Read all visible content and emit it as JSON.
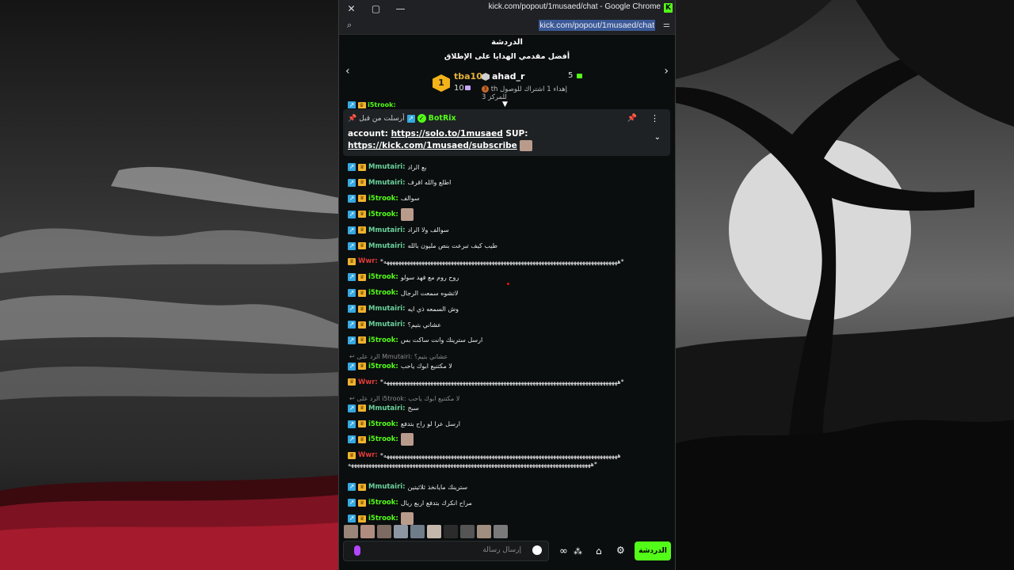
{
  "browser": {
    "title": "kick.com/popout/1musaed/chat - Google Chrome",
    "url": "kick.com/popout/1musaed/chat",
    "controls": {
      "close": "✕",
      "maximize": "▢",
      "minimize": "—"
    }
  },
  "chat": {
    "header": "الدردشة",
    "gifters_title": "أفضل مقدمي الهدايا على الإطلاق",
    "gifters": [
      {
        "rank": "1",
        "name": "tba10",
        "count": "10"
      },
      {
        "rank": "",
        "name": "ahad_r",
        "count": "5"
      }
    ],
    "third_note": "th إهداء 1 اشتراك للوصول للمركز 3",
    "third_badge": "3",
    "peek_text": "i5trook:",
    "pinned": {
      "label": "أرسلت من قبل",
      "author": "BotRix",
      "text_prefix": "account: ",
      "link1": "https://solo.to/1musaed",
      "mid": " SUP: ",
      "link2": "https://kick.com/1musaed/subscribe"
    },
    "messages": [
      {
        "user": "Mmutairi:",
        "color": "#6ad39c",
        "text": "بع الراد",
        "badges": "both"
      },
      {
        "user": "Mmutairi:",
        "color": "#6ad39c",
        "text": "اطلع والله اقرف",
        "badges": "both"
      },
      {
        "user": "i5trook:",
        "color": "#53fc18",
        "text": "سوالف",
        "badges": "both"
      },
      {
        "user": "i5trook:",
        "color": "#53fc18",
        "text": "",
        "badges": "both",
        "emote": true
      },
      {
        "user": "Mmutairi:",
        "color": "#6ad39c",
        "text": "سوالف ولا الراد",
        "badges": "both"
      },
      {
        "user": "Mmutairi:",
        "color": "#6ad39c",
        "text": "طيب كيف تبرعت بنص مليون بالله",
        "badges": "both"
      },
      {
        "user": "Wwr:",
        "color": "#e33b3b",
        "text": "*ههههههههههههههههههههههههههههههههههههههههههههههههههههههههههههههههههههههههههههههههه*",
        "badges": "crown"
      },
      {
        "user": "i5trook:",
        "color": "#53fc18",
        "text": "روح روم مع فهد سولو",
        "badges": "both"
      },
      {
        "user": "i5trook:",
        "color": "#53fc18",
        "text": "لاتشوه سمعت الرجال",
        "badges": "both"
      },
      {
        "user": "Mmutairi:",
        "color": "#6ad39c",
        "text": "وش السمعه ذي ايه",
        "badges": "both"
      },
      {
        "user": "Mmutairi:",
        "color": "#6ad39c",
        "text": "عشاني بتيم؟",
        "badges": "both"
      },
      {
        "user": "i5trook:",
        "color": "#53fc18",
        "text": "ارسل سترينك وانت ساكت بس",
        "badges": "both"
      }
    ],
    "reply1_header": "الرد على Mmutairi: عشاني بتيم؟",
    "messages2": [
      {
        "user": "i5trook:",
        "color": "#53fc18",
        "text": "لا مكتنيع ابوك ياحب",
        "badges": "both"
      },
      {
        "user": "Wwr:",
        "color": "#e33b3b",
        "text": "*ههههههههههههههههههههههههههههههههههههههههههههههههههههههههههههههههههههههههههههههههه*",
        "badges": "crown"
      }
    ],
    "reply2_header": "الرد على i5trook: لا مكتنيع ابوك ياحب",
    "messages3": [
      {
        "user": "Mmutairi:",
        "color": "#6ad39c",
        "text": "سبح",
        "badges": "both"
      },
      {
        "user": "i5trook:",
        "color": "#53fc18",
        "text": "ارسل عرا لو راح بتدفع",
        "badges": "both"
      },
      {
        "user": "i5trook:",
        "color": "#53fc18",
        "text": "",
        "badges": "both",
        "emote": true
      },
      {
        "user": "Wwr:",
        "color": "#e33b3b",
        "text": "*ههههههههههههههههههههههههههههههههههههههههههههههههههههههههههههههههههههههههههههههههه",
        "badges": "crown"
      },
      {
        "user": "",
        "color": "#e9e9e9",
        "text": "هههههههههههههههههههههههههههههههههههههههههههههههههههههههههههههههههههههههههههههههههههه*",
        "badges": "none"
      },
      {
        "user": "Mmutairi:",
        "color": "#6ad39c",
        "text": "سترينك مايانخذ ثلاثيتين",
        "badges": "both"
      },
      {
        "user": "i5trook:",
        "color": "#53fc18",
        "text": "مراح انكرك بتدفع اربع ريال",
        "badges": "both"
      },
      {
        "user": "i5trook:",
        "color": "#53fc18",
        "text": "",
        "badges": "both",
        "emote": true
      }
    ],
    "input_placeholder": "إرسال رسالة",
    "send_label": "الدردشة",
    "emote_count": 10
  }
}
